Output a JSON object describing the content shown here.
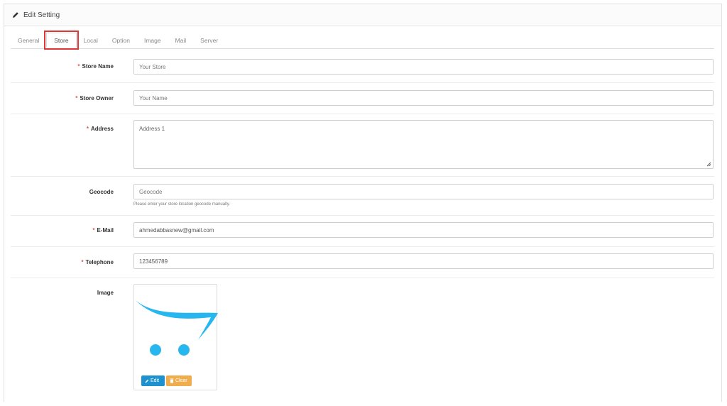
{
  "panel": {
    "title": "Edit Setting"
  },
  "tabs": [
    {
      "label": "General",
      "active": false
    },
    {
      "label": "Store",
      "active": true
    },
    {
      "label": "Local",
      "active": false
    },
    {
      "label": "Option",
      "active": false
    },
    {
      "label": "Image",
      "active": false
    },
    {
      "label": "Mail",
      "active": false
    },
    {
      "label": "Server",
      "active": false
    }
  ],
  "form": {
    "required_mark": "*",
    "store_name": {
      "label": "Store Name",
      "placeholder": "Your Store",
      "value": ""
    },
    "store_owner": {
      "label": "Store Owner",
      "placeholder": "Your Name",
      "value": ""
    },
    "address": {
      "label": "Address",
      "placeholder": "Address 1",
      "value": ""
    },
    "geocode": {
      "label": "Geocode",
      "placeholder": "Geocode",
      "value": "",
      "help": "Please enter your store location geocode manually."
    },
    "email": {
      "label": "E-Mail",
      "value": "ahmedabbasnew@gmail.com"
    },
    "telephone": {
      "label": "Telephone",
      "value": "123456789"
    },
    "image": {
      "label": "Image",
      "edit_label": "Edit",
      "clear_label": "Clear"
    }
  },
  "colors": {
    "required": "#d9534f",
    "edit_button": "#1e91cf",
    "clear_button": "#f0ad4e",
    "logo": "#28b6ee",
    "tab_highlight": "#e03535"
  },
  "icons": {
    "panel": "pencil-icon",
    "edit": "pencil-icon",
    "clear": "trash-icon",
    "resize": "resize-handle-icon"
  }
}
